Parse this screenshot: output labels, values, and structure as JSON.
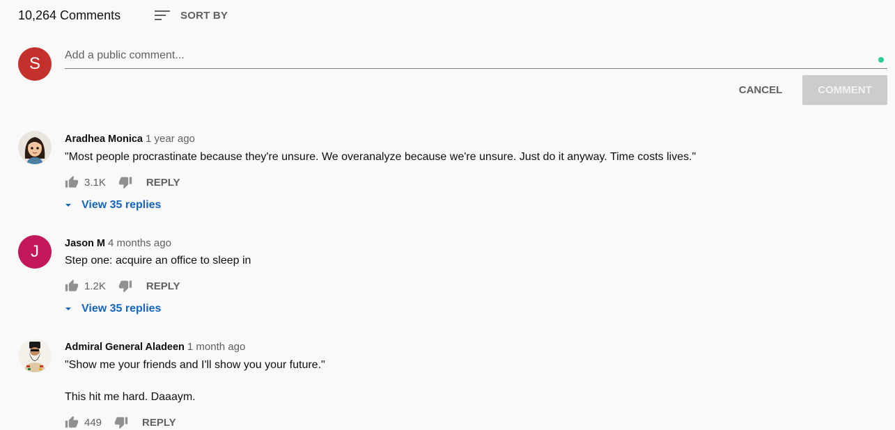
{
  "header": {
    "comment_count": "10,264 Comments",
    "sort_label": "SORT BY"
  },
  "composer": {
    "avatar_letter": "S",
    "avatar_color": "#c4302b",
    "placeholder": "Add a public comment...",
    "cancel_label": "CANCEL",
    "comment_label": "COMMENT",
    "status_color": "#2bcc9a"
  },
  "comments": [
    {
      "author": "Aradhea Monica",
      "time": "1 year ago",
      "avatar_icon": "cartoon-girl-avatar",
      "lines": [
        "\"Most people procrastinate because they're unsure. We overanalyze because we're unsure. Just do it anyway. Time costs lives.\""
      ],
      "likes": "3.1K",
      "reply_label": "REPLY",
      "view_replies": "View 35 replies"
    },
    {
      "author": "Jason M",
      "time": "4 months ago",
      "avatar_letter": "J",
      "avatar_color": "#c2185b",
      "lines": [
        "Step one: acquire an office to sleep in"
      ],
      "likes": "1.2K",
      "reply_label": "REPLY",
      "view_replies": "View 35 replies"
    },
    {
      "author": "Admiral General Aladeen",
      "time": "1 month ago",
      "avatar_icon": "bearded-general-avatar",
      "lines": [
        "\"Show me your friends and I'll show you your future.\"",
        "This hit me hard. Daaaym."
      ],
      "likes": "449",
      "reply_label": "REPLY"
    }
  ]
}
